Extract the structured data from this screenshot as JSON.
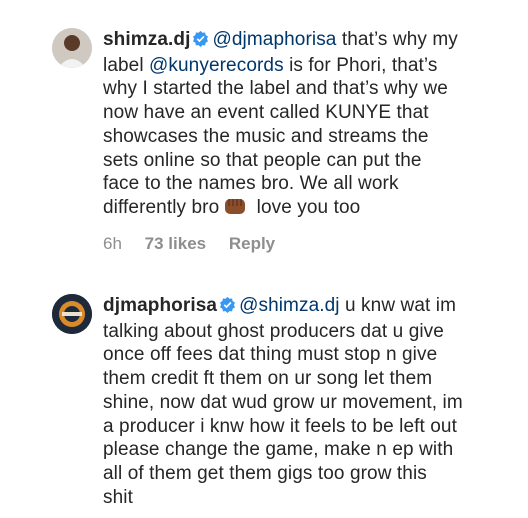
{
  "comments": [
    {
      "username": "shimza.dj",
      "verified": true,
      "mention": "@djmaphorisa",
      "text_a": " that’s why my",
      "line2_a": "label ",
      "mention2": "@kunyerecords",
      "line2_b": " is for Phori, that’s",
      "line3": "why I started the label and that’s why we",
      "line4": "now have an event called KUNYE that",
      "line5": "showcases the music and streams the",
      "line6": "sets online so that people can put the",
      "line7": "face to the names bro. We all work",
      "line8_a": "differently bro",
      "line8_b": " love you too",
      "emoji": "fist-bump-emoji",
      "time": "6h",
      "likes": "73 likes",
      "reply": "Reply"
    },
    {
      "username": "djmaphorisa",
      "verified": true,
      "mention": "@shimza.dj",
      "text_a": " u knw wat im",
      "line2": "talking about ghost producers dat u give",
      "line3": "once off fees dat thing must stop n give",
      "line4": "them credit ft them on ur song let them",
      "line5": "shine, now dat wud grow ur movement, im",
      "line6": "a producer i knw how it feels to be left out",
      "line7": "please change the game, make n ep with",
      "line8": "all of them get them gigs too grow this",
      "line9": "shit"
    }
  ],
  "colors": {
    "text": "#262626",
    "mention": "#00376b",
    "meta": "#8e8e8e",
    "verified": "#3897f0"
  }
}
